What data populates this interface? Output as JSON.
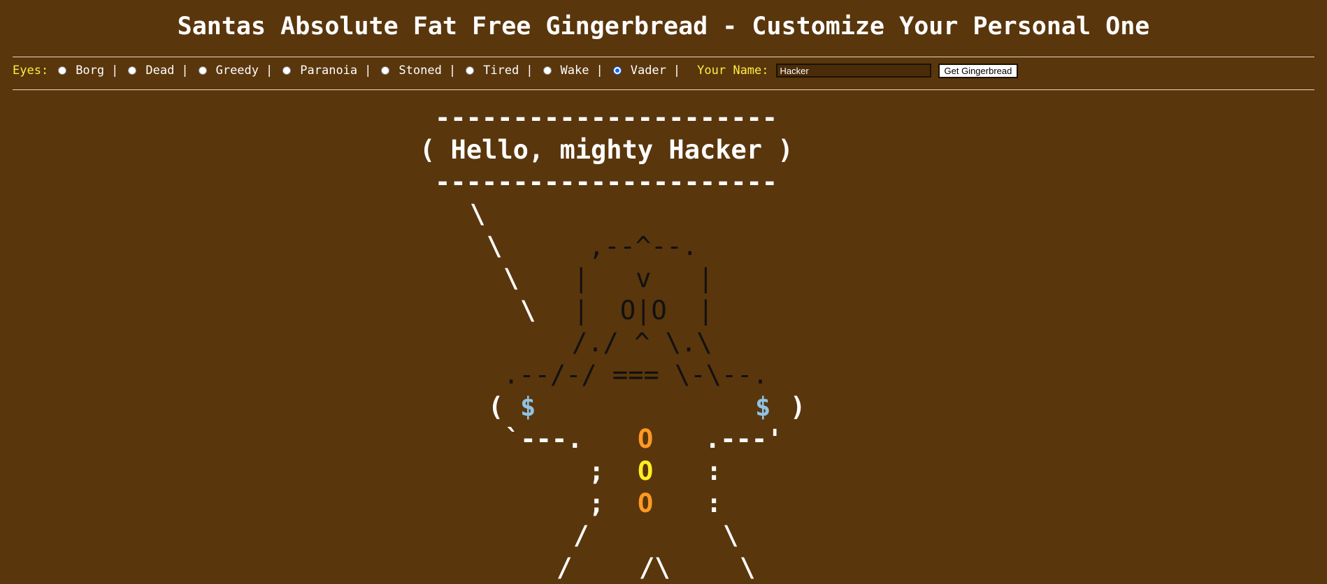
{
  "title": "Santas Absolute Fat Free Gingerbread - Customize Your Personal One",
  "eyes_label": "Eyes:",
  "eye_options": [
    {
      "label": "Borg",
      "checked": false
    },
    {
      "label": "Dead",
      "checked": false
    },
    {
      "label": "Greedy",
      "checked": false
    },
    {
      "label": "Paranoia",
      "checked": false
    },
    {
      "label": "Stoned",
      "checked": false
    },
    {
      "label": "Tired",
      "checked": false
    },
    {
      "label": "Wake",
      "checked": false
    },
    {
      "label": "Vader",
      "checked": true
    }
  ],
  "separator": "|",
  "name_label": "Your Name:",
  "name_value": "Hacker",
  "button_label": "Get Gingerbread",
  "art": {
    "bubble_top": "----------------------",
    "bubble_text": "( Hello, mighty Hacker )",
    "bubble_bottom": "----------------------",
    "tail": [
      "\\",
      "\\",
      "\\",
      "\\"
    ],
    "head": [
      ",--^--.",
      "|   v   |",
      "|  O|O  |",
      "/./ ^ \\.\\",
      ".--/-/ === \\-\\--."
    ],
    "arm_left": "(",
    "arm_right": ")",
    "dollar": "$",
    "waist_left": "`---.",
    "waist_right": ".---'",
    "legs_left": [
      ";",
      ";"
    ],
    "legs_right": [
      ":",
      ":"
    ],
    "button": "O",
    "feet": [
      "/",
      "/\\",
      "\\",
      "/",
      "\\"
    ]
  },
  "colors": {
    "background": "#5a360c",
    "label": "#ffee44",
    "dollar": "#8ec3e6",
    "button_orange": "#ff9922",
    "button_yellow": "#ffee22",
    "head": "#111111"
  }
}
